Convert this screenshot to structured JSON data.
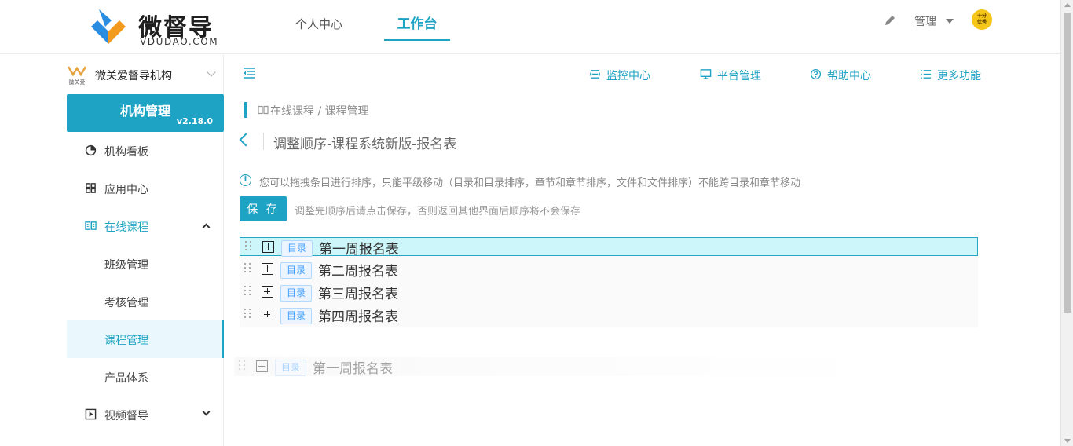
{
  "brand": {
    "name": "微督导",
    "domain": "VDUDAO.COM",
    "color": "#1fa3c4"
  },
  "top_nav": [
    {
      "label": "个人中心",
      "active": false
    },
    {
      "label": "工作台",
      "active": true
    }
  ],
  "user_menu": {
    "label": "管理",
    "avatar_text_top": "十分",
    "avatar_text_bottom": "优秀"
  },
  "sidebar": {
    "org_logo_caption": "微关爱",
    "org_name": "微关爱督导机构",
    "card_title": "机构管理",
    "version": "v2.18.0",
    "items": [
      {
        "label": "机构看板",
        "icon": "pie-chart-icon"
      },
      {
        "label": "应用中心",
        "icon": "grid-icon"
      },
      {
        "label": "在线课程",
        "icon": "book-icon",
        "expanded": true
      },
      {
        "label": "班级管理",
        "sub": true
      },
      {
        "label": "考核管理",
        "sub": true
      },
      {
        "label": "课程管理",
        "sub": true,
        "selected": true
      },
      {
        "label": "产品体系",
        "sub": true
      },
      {
        "label": "视频督导",
        "icon": "play-icon",
        "expanded": false
      }
    ]
  },
  "toolbar": {
    "items": [
      {
        "label": "监控中心",
        "icon": "monitor-list-icon"
      },
      {
        "label": "平台管理",
        "icon": "desktop-icon"
      },
      {
        "label": "帮助中心",
        "icon": "help-icon"
      },
      {
        "label": "更多功能",
        "icon": "more-list-icon"
      }
    ]
  },
  "breadcrumb": "在线课程 / 课程管理",
  "page_title": "调整顺序-课程系统新版-报名表",
  "info_text": "您可以拖拽条目进行排序，只能平级移动（目录和目录排序，章节和章节排序，文件和文件排序）不能跨目录和章节移动",
  "save_label": "保 存",
  "save_tip": "调整完顺序后请点击保存，否则返回其他界面后顺序将不会保存",
  "tree": {
    "tag_label": "目录",
    "rows": [
      {
        "name": "第一周报名表",
        "highlighted": true
      },
      {
        "name": "第二周报名表",
        "highlighted": false
      },
      {
        "name": "第三周报名表",
        "highlighted": false
      },
      {
        "name": "第四周报名表",
        "highlighted": false
      }
    ],
    "dragging": {
      "name": "第一周报名表"
    }
  }
}
